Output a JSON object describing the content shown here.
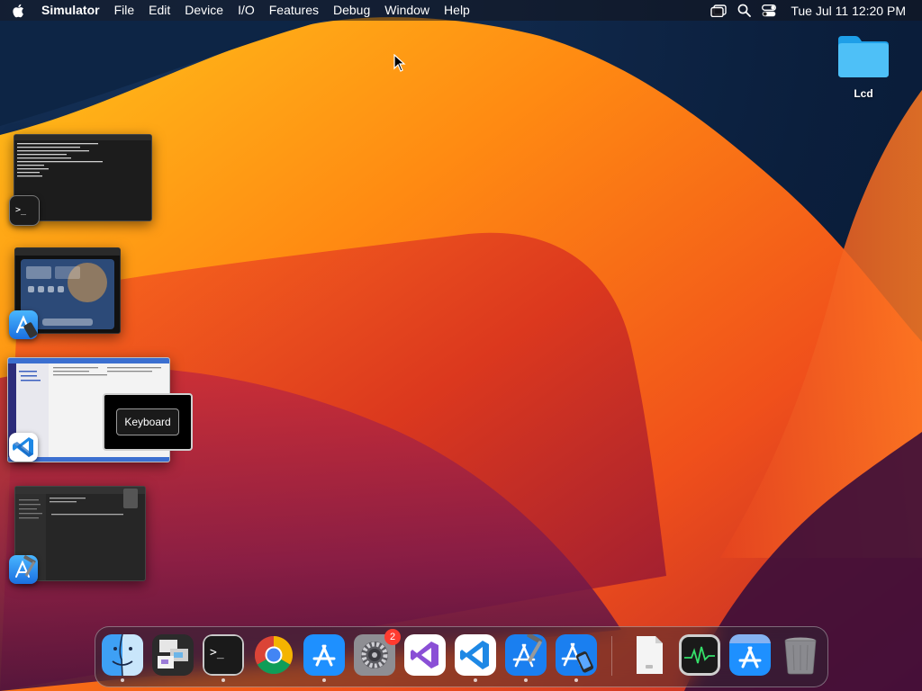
{
  "menubar": {
    "app_name": "Simulator",
    "items": [
      "File",
      "Edit",
      "Device",
      "I/O",
      "Features",
      "Debug",
      "Window",
      "Help"
    ],
    "clock": "Tue Jul 11  12:20 PM"
  },
  "desktop": {
    "folder_label": "Lcd"
  },
  "stage_manager": {
    "tooltip": "Keyboard"
  },
  "dock": {
    "settings_badge": "2"
  },
  "colors": {
    "accent_blue": "#1e88e5",
    "badge_red": "#ff3b30"
  }
}
